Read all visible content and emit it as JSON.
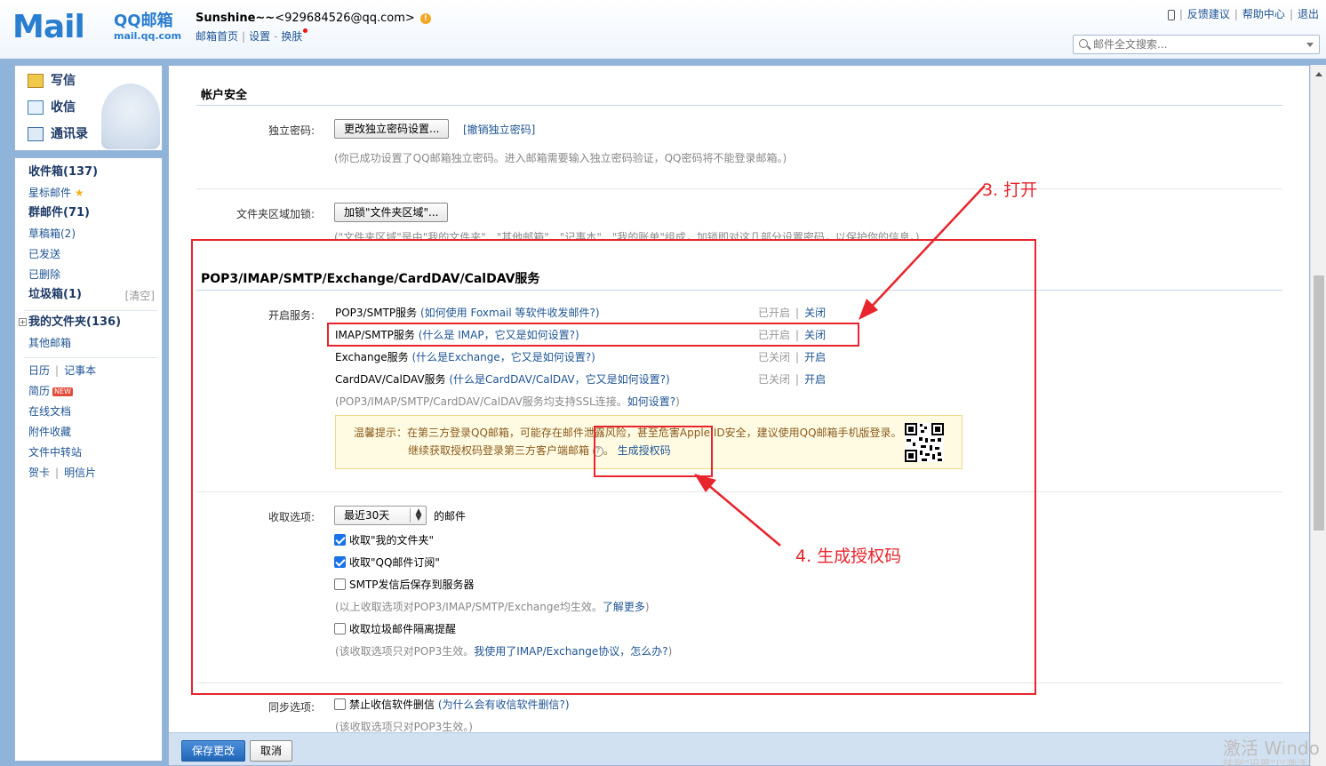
{
  "header": {
    "logo_text": "Mail",
    "brand_cn": "QQ邮箱",
    "brand_domain": "mail.qq.com",
    "nickname": "Sunshine~~",
    "email": "<929684526@qq.com>",
    "warn_mark": "!",
    "links": [
      "邮箱首页",
      "设置",
      "换肤"
    ],
    "top_right": [
      "反馈建议",
      "帮助中心",
      "退出"
    ],
    "search_placeholder": "邮件全文搜索..."
  },
  "nav_top": {
    "compose": "写信",
    "inbox": "收信",
    "contacts": "通讯录"
  },
  "nav": {
    "inbox": "收件箱(137)",
    "starred": "星标邮件",
    "group": "群邮件(71)",
    "drafts": "草稿箱(2)",
    "sent": "已发送",
    "deleted": "已删除",
    "spam": "垃圾箱(1)",
    "spam_clear": "[清空]",
    "my_folders": "我的文件夹(136)",
    "other_mail": "其他邮箱",
    "calendar": "日历",
    "notes": "记事本",
    "resume": "简历",
    "resume_badge": "NEW",
    "online_docs": "在线文档",
    "attachments": "附件收藏",
    "file_transfer": "文件中转站",
    "greeting_card": "贺卡",
    "postcard": "明信片"
  },
  "account_security": {
    "title": "帐户安全",
    "password_label": "独立密码:",
    "password_button": "更改独立密码设置...",
    "password_revoke": "[撤销独立密码]",
    "password_note": "(你已成功设置了QQ邮箱独立密码。进入邮箱需要输入独立密码验证，QQ密码将不能登录邮箱。)",
    "folder_lock_label": "文件夹区域加锁:",
    "folder_lock_button": "加锁\"文件夹区域\"...",
    "folder_lock_note": "(\"文件夹区域\"是由\"我的文件夹\"、\"其他邮箱\"、\"记事本\"、\"我的账单\"组成，加锁即对这几部分设置密码，以保护你的信息。)"
  },
  "services": {
    "title": "POP3/IMAP/SMTP/Exchange/CardDAV/CalDAV服务",
    "enable_label": "开启服务:",
    "rows": [
      {
        "name": "POP3/SMTP服务",
        "help": "(如何使用 Foxmail 等软件收发邮件?)",
        "status": "已开启",
        "action": "关闭"
      },
      {
        "name": "IMAP/SMTP服务",
        "help": "(什么是 IMAP，它又是如何设置?)",
        "status": "已开启",
        "action": "关闭"
      },
      {
        "name": "Exchange服务",
        "help": "(什么是Exchange，它又是如何设置?)",
        "status": "已关闭",
        "action": "开启"
      },
      {
        "name": "CardDAV/CalDAV服务",
        "help": "(什么是CardDAV/CalDAV，它又是如何设置?)",
        "status": "已关闭",
        "action": "开启"
      }
    ],
    "ssl_note": "(POP3/IMAP/SMTP/CardDAV/CalDAV服务均支持SSL连接。",
    "ssl_link": "如何设置?",
    "ssl_close": ")",
    "tip_line1": "温馨提示：在第三方登录QQ邮箱，可能存在邮件泄露风险，甚至危害Apple ID安全，建议使用QQ邮箱手机版登录。",
    "tip_line2": "继续获取授权码登录第三方客户端邮箱",
    "tip_help": "?",
    "tip_link": "生成授权码"
  },
  "receive": {
    "label": "收取选项:",
    "range_value": "最近30天",
    "range_suffix": "的邮件",
    "opt_folders": "收取\"我的文件夹\"",
    "opt_subscriptions": "收取\"QQ邮件订阅\"",
    "opt_smtp_save": "SMTP发信后保存到服务器",
    "opt_note": "(以上收取选项对POP3/IMAP/SMTP/Exchange均生效。",
    "opt_note_link": "了解更多",
    "opt_note_close": ")",
    "opt_spam": "收取垃圾邮件隔离提醒",
    "spam_note": "(该收取选项只对POP3生效。",
    "spam_note_link": "我使用了IMAP/Exchange协议，怎么办?",
    "spam_note_close": ")",
    "checked": {
      "folders": true,
      "subscriptions": true,
      "smtp_save": false,
      "spam": false
    }
  },
  "sync": {
    "label": "同步选项:",
    "opt": "禁止收信软件删信",
    "opt_help": "(为什么会有收信软件删信?)",
    "note": "(该收取选项只对POP3生效。)"
  },
  "bottom": {
    "save": "保存更改",
    "cancel": "取消"
  },
  "annotations": {
    "step3": "3. 打开",
    "step4": "4. 生成授权码"
  },
  "watermark": {
    "line1": "激活 Windo",
    "line2": "转到\"设置\"以激活"
  },
  "colors": {
    "link": "#1e5494",
    "annotation": "#e8242c",
    "primary_button": "#2266b8"
  }
}
